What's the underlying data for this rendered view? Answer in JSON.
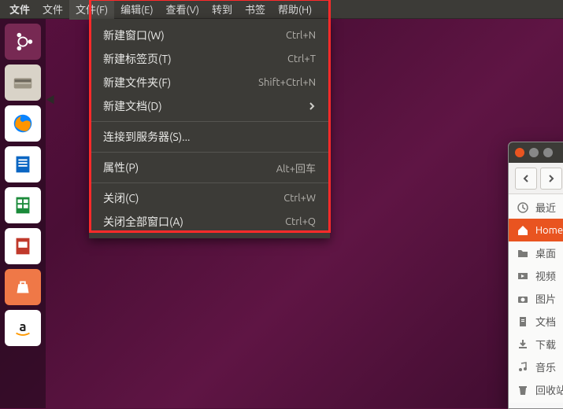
{
  "menubar": {
    "app_title": "文件",
    "items": [
      "文件",
      "文件(F)",
      "编辑(E)",
      "查看(V)",
      "转到",
      "书签",
      "帮助(H)"
    ]
  },
  "dropdown": {
    "items": [
      {
        "label": "新建窗口(W)",
        "accel": "Ctrl+N",
        "type": "item"
      },
      {
        "label": "新建标签页(T)",
        "accel": "Ctrl+T",
        "type": "item"
      },
      {
        "label": "新建文件夹(F)",
        "accel": "Shift+Ctrl+N",
        "type": "item"
      },
      {
        "label": "新建文档(D)",
        "submenu": true,
        "type": "item"
      },
      {
        "type": "sep"
      },
      {
        "label": "连接到服务器(S)...",
        "type": "item"
      },
      {
        "type": "sep"
      },
      {
        "label": "属性(P)",
        "accel": "Alt+回车",
        "type": "item"
      },
      {
        "type": "sep"
      },
      {
        "label": "关闭(C)",
        "accel": "Ctrl+W",
        "type": "item"
      },
      {
        "label": "关闭全部窗口(A)",
        "accel": "Ctrl+Q",
        "type": "item"
      }
    ]
  },
  "launcher": {
    "items": [
      {
        "name": "ubuntu-dash",
        "bg": "#dd4814"
      },
      {
        "name": "files",
        "bg": "#eeeeee"
      },
      {
        "name": "firefox",
        "bg": "#ffffff"
      },
      {
        "name": "libreoffice-writer",
        "bg": "#ffffff"
      },
      {
        "name": "libreoffice-calc",
        "bg": "#ffffff"
      },
      {
        "name": "libreoffice-impress",
        "bg": "#ffffff"
      },
      {
        "name": "ubuntu-software",
        "bg": "#ef7847"
      },
      {
        "name": "amazon",
        "bg": "#ffffff"
      }
    ]
  },
  "file_manager": {
    "sidebar": [
      {
        "icon": "clock",
        "label": "最近"
      },
      {
        "icon": "home",
        "label": "Home",
        "selected": true
      },
      {
        "icon": "folder",
        "label": "桌面"
      },
      {
        "icon": "video",
        "label": "视频"
      },
      {
        "icon": "camera",
        "label": "图片"
      },
      {
        "icon": "document",
        "label": "文档"
      },
      {
        "icon": "download",
        "label": "下载"
      },
      {
        "icon": "music",
        "label": "音乐"
      },
      {
        "icon": "trash",
        "label": "回收站"
      }
    ]
  }
}
